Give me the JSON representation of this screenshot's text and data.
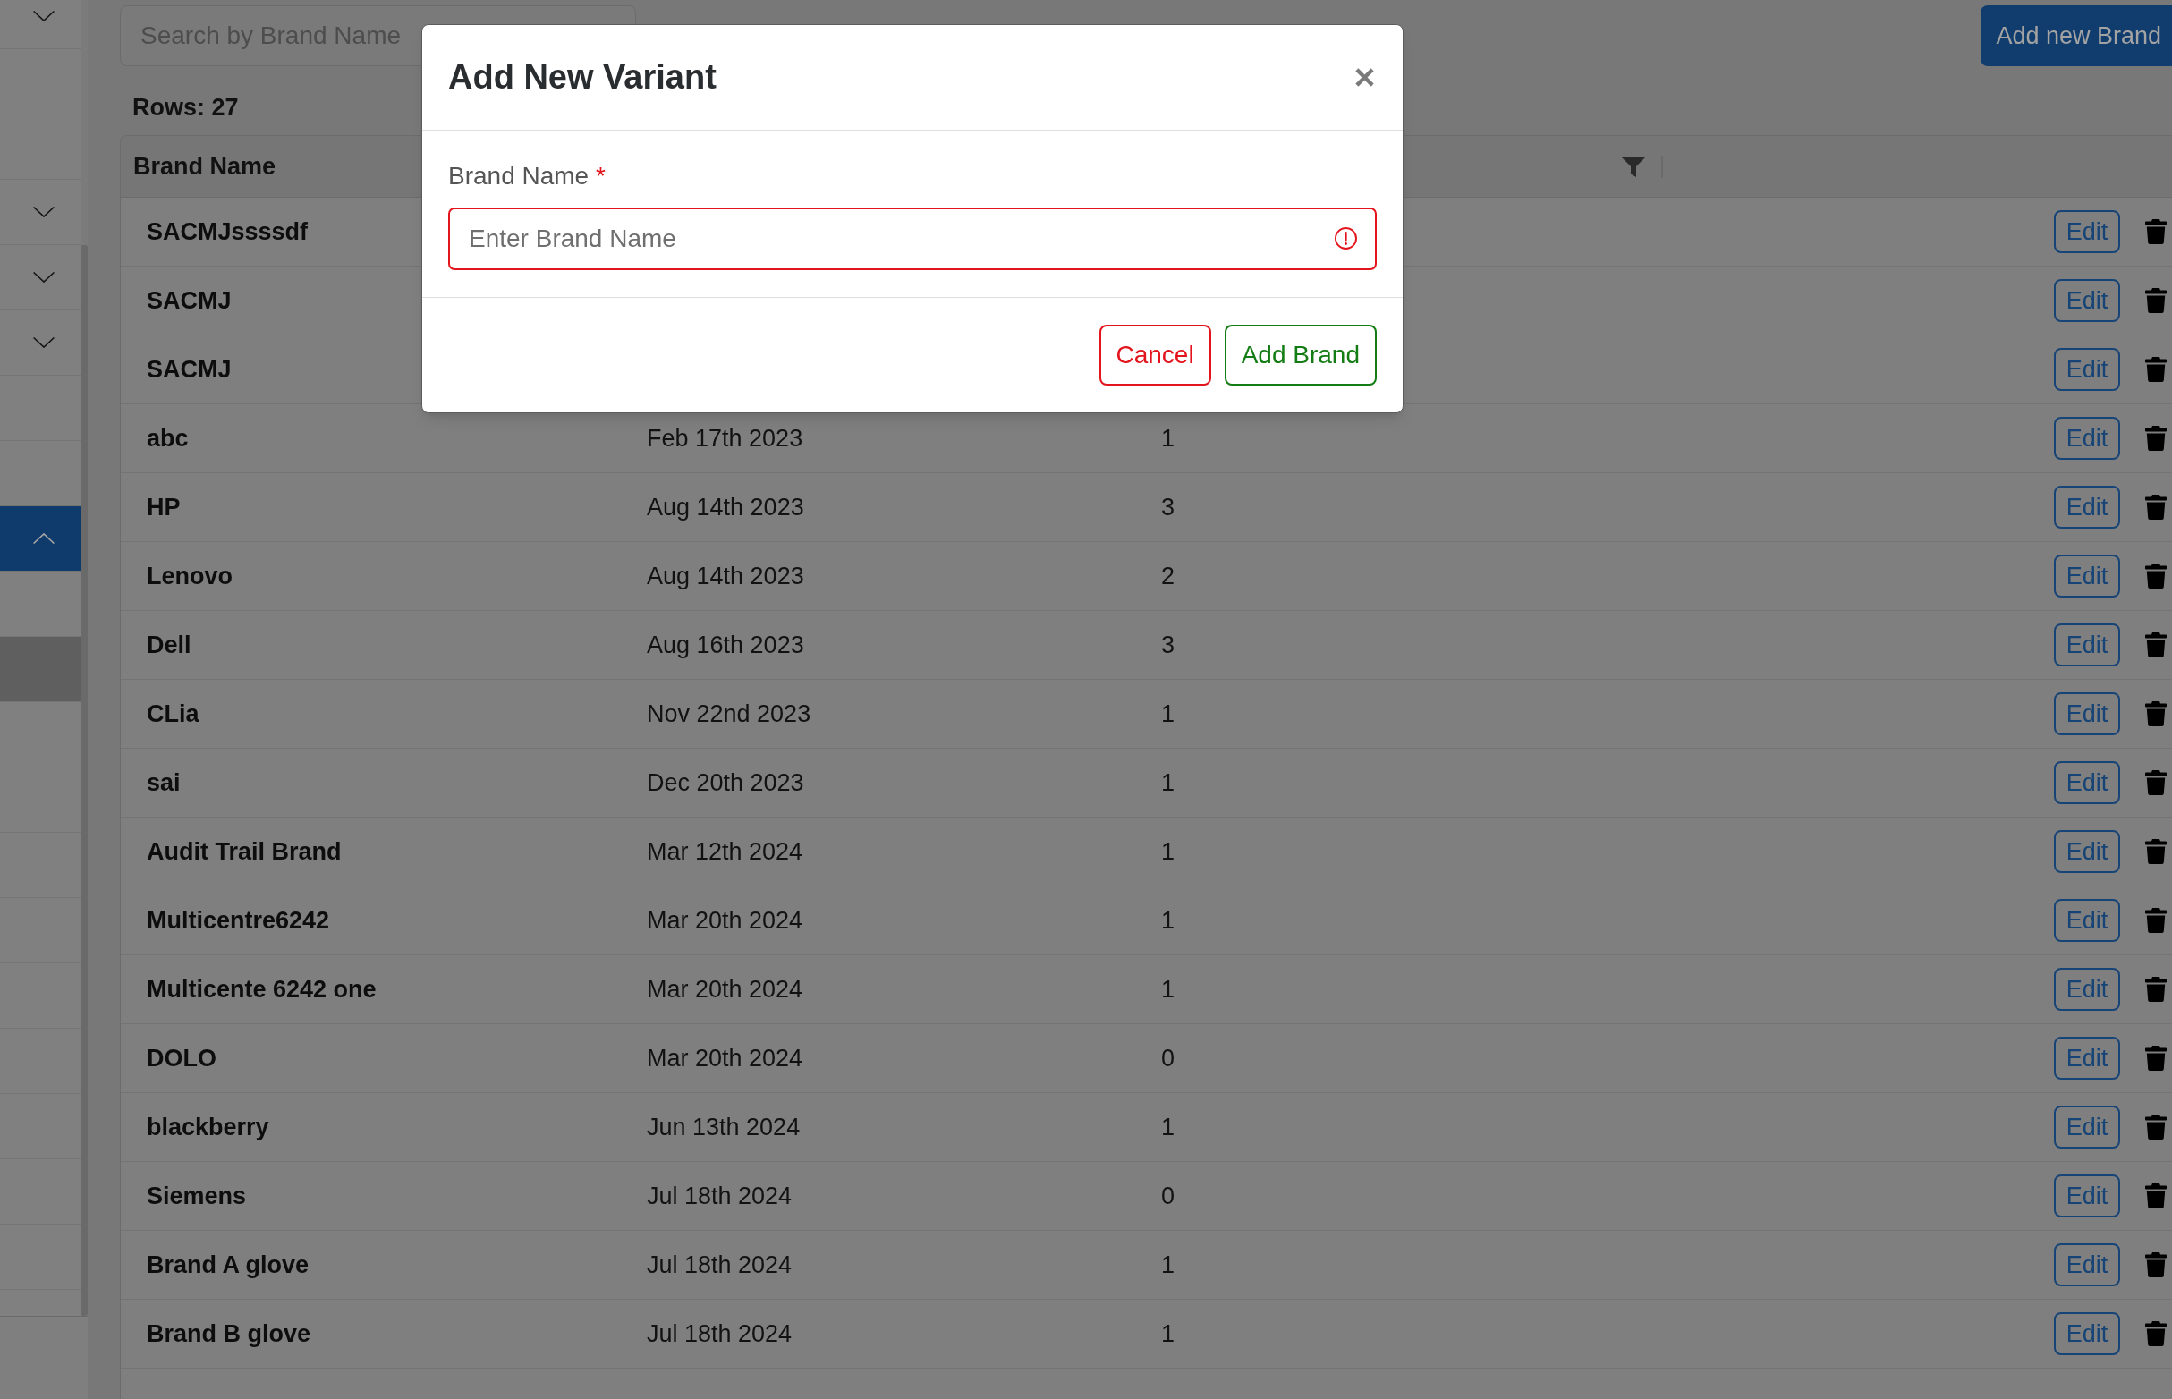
{
  "sidebar": {
    "items": [
      {
        "kind": "group",
        "expanded": false,
        "selected": false
      },
      {
        "kind": "link",
        "selected": false
      },
      {
        "kind": "link",
        "selected": false
      },
      {
        "kind": "group",
        "expanded": false,
        "selected": false
      },
      {
        "kind": "group",
        "expanded": false,
        "selected": false
      },
      {
        "kind": "group",
        "expanded": false,
        "selected": false
      },
      {
        "kind": "link",
        "selected": false
      },
      {
        "kind": "link",
        "selected": false
      },
      {
        "kind": "group",
        "expanded": true,
        "selected": true,
        "children": [
          {
            "selected": false
          },
          {
            "selected": true
          },
          {
            "selected": false
          },
          {
            "selected": false
          },
          {
            "selected": false
          },
          {
            "selected": false
          },
          {
            "selected": false
          },
          {
            "selected": false
          },
          {
            "selected": false
          },
          {
            "selected": false
          },
          {
            "selected": false
          }
        ]
      }
    ]
  },
  "search": {
    "placeholder": "Search by Brand Name"
  },
  "add_button": {
    "label": "Add new Brand"
  },
  "row_count": "Rows: 27",
  "table": {
    "columns": [
      {
        "label": "Brand Name"
      }
    ],
    "rows": [
      {
        "brand_name": "SACMJssssdf",
        "action": "Edit"
      },
      {
        "brand_name": "SACMJ",
        "action": "Edit"
      },
      {
        "brand_name": "SACMJ",
        "action": "Edit"
      },
      {
        "brand_name": "abc",
        "column_2": "Feb 17th 2023",
        "column_3": "1",
        "action": "Edit"
      },
      {
        "brand_name": "HP",
        "column_2": "Aug 14th 2023",
        "column_3": "3",
        "action": "Edit"
      },
      {
        "brand_name": "Lenovo",
        "column_2": "Aug 14th 2023",
        "column_3": "2",
        "action": "Edit"
      },
      {
        "brand_name": "Dell",
        "column_2": "Aug 16th 2023",
        "column_3": "3",
        "action": "Edit"
      },
      {
        "brand_name": "CLia",
        "column_2": "Nov 22nd 2023",
        "column_3": "1",
        "action": "Edit"
      },
      {
        "brand_name": "sai",
        "column_2": "Dec 20th 2023",
        "column_3": "1",
        "action": "Edit"
      },
      {
        "brand_name": "Audit Trail Brand",
        "column_2": "Mar 12th 2024",
        "column_3": "1",
        "action": "Edit"
      },
      {
        "brand_name": "Multicentre6242",
        "column_2": "Mar 20th 2024",
        "column_3": "1",
        "action": "Edit"
      },
      {
        "brand_name": "Multicente 6242 one",
        "column_2": "Mar 20th 2024",
        "column_3": "1",
        "action": "Edit"
      },
      {
        "brand_name": "DOLO",
        "column_2": "Mar 20th 2024",
        "column_3": "0",
        "action": "Edit"
      },
      {
        "brand_name": "blackberry",
        "column_2": "Jun 13th 2024",
        "column_3": "1",
        "action": "Edit"
      },
      {
        "brand_name": "Siemens",
        "column_2": "Jul 18th 2024",
        "column_3": "0",
        "action": "Edit"
      },
      {
        "brand_name": "Brand A glove",
        "column_2": "Jul 18th 2024",
        "column_3": "1",
        "action": "Edit"
      },
      {
        "brand_name": "Brand B glove",
        "column_2": "Jul 18th 2024",
        "column_3": "1",
        "action": "Edit"
      }
    ]
  },
  "modal": {
    "title": "Add New Variant",
    "field": {
      "label": "Brand Name",
      "required_mark": "*",
      "placeholder": "Enter Brand Name",
      "invalid": true
    },
    "buttons": [
      {
        "label": "Cancel",
        "kind": "cancel"
      },
      {
        "label": "Add Brand",
        "kind": "confirm"
      }
    ]
  }
}
